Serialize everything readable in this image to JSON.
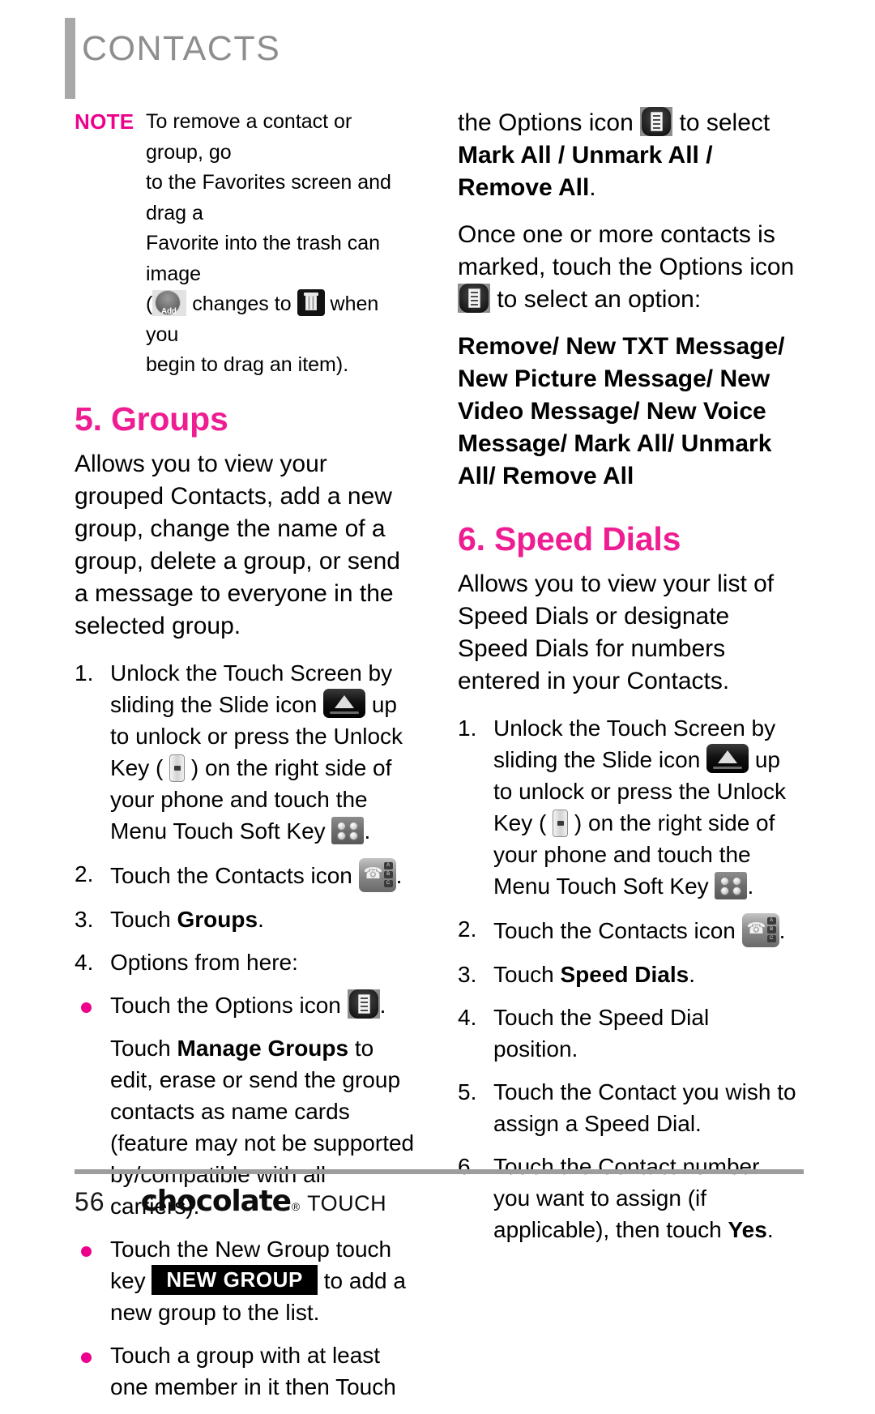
{
  "header": {
    "chapter_title": "CONTACTS"
  },
  "note": {
    "label": "NOTE",
    "line1": "To remove a contact or group, go",
    "line2": "to the Favorites screen and drag a",
    "line3": "Favorite into the trash can image",
    "line4_open": "(",
    "line4_mid": "changes to",
    "line4_end": "when you",
    "line5": "begin to drag an item).",
    "add_icon_label": "Add"
  },
  "sections": {
    "groups": {
      "heading": "5. Groups",
      "intro": "Allows you to view your grouped Contacts, add a new group, change the name of a group, delete a group, or send a message to everyone in the selected group.",
      "steps": [
        {
          "num": "1.",
          "part1": "Unlock the Touch Screen by sliding the Slide icon",
          "part2": "up to unlock or press the Unlock Key (",
          "part3": ") on the right side of your phone and touch the Menu Touch Soft Key",
          "part4": "."
        },
        {
          "num": "2.",
          "part1": "Touch the Contacts icon",
          "part2": "."
        },
        {
          "num": "3.",
          "part1": "Touch ",
          "bold": "Groups",
          "part2": "."
        },
        {
          "num": "4.",
          "part1": "Options from here:"
        }
      ],
      "bullets": [
        {
          "part1": "Touch the Options icon",
          "part2": "."
        },
        {
          "part1": "Touch the New Group touch key",
          "key_label": "NEW GROUP",
          "part2": "to add a new group to the list."
        },
        {
          "part1": "Touch a group with at least one member in it then Touch"
        }
      ],
      "manage_groups_para": {
        "pre": "Touch ",
        "bold": "Manage Groups",
        "post": " to edit, erase or send the group contacts as name cards (feature may not be supported by/compatible with all carriers)."
      }
    },
    "continuation": {
      "para1_part1": "the Options icon",
      "para1_part2": "to select ",
      "para1_bold1": "Mark All / Unmark All / Remove All",
      "para1_part3": ".",
      "para2_part1": "Once one or more contacts is marked, touch the Options icon",
      "para2_part2": "to select an option:",
      "options_list": "Remove/ New TXT Message/ New Picture Message/ New Video Message/ New Voice Message/ Mark All/ Unmark All/ Remove All"
    },
    "speed_dials": {
      "heading": "6. Speed Dials",
      "intro": "Allows you to view your list of Speed Dials or designate Speed Dials for numbers entered in your Contacts.",
      "steps": [
        {
          "num": "1.",
          "part1": "Unlock the Touch Screen by sliding the Slide icon",
          "part2": "up to unlock or press the Unlock Key (",
          "part3": ") on the right side of your phone and touch the Menu Touch Soft Key",
          "part4": "."
        },
        {
          "num": "2.",
          "part1": "Touch the Contacts icon",
          "part2": "."
        },
        {
          "num": "3.",
          "part1": "Touch ",
          "bold": "Speed Dials",
          "part2": "."
        },
        {
          "num": "4.",
          "part1": "Touch the Speed Dial position."
        },
        {
          "num": "5.",
          "part1": "Touch the Contact you wish to assign a Speed Dial."
        },
        {
          "num": "6.",
          "part1": "Touch the Contact number you want to assign (if applicable), then touch ",
          "bold": "Yes",
          "part2": "."
        }
      ]
    }
  },
  "footer": {
    "page_number": "56",
    "brand_name": "chocolate",
    "brand_reg": "®",
    "brand_sub": "TOUCH"
  },
  "colors": {
    "accent_magenta": "#ed008c",
    "header_gray": "#8e8e8e",
    "rule_gray": "#9d9d9d"
  },
  "icons": {
    "add": "add-button-icon",
    "trash": "trash-can-icon",
    "options": "options-list-icon",
    "slide": "slide-unlock-icon",
    "unlock_key": "unlock-key-icon",
    "menu_soft_key": "menu-touch-soft-key-icon",
    "contacts": "contacts-icon"
  }
}
